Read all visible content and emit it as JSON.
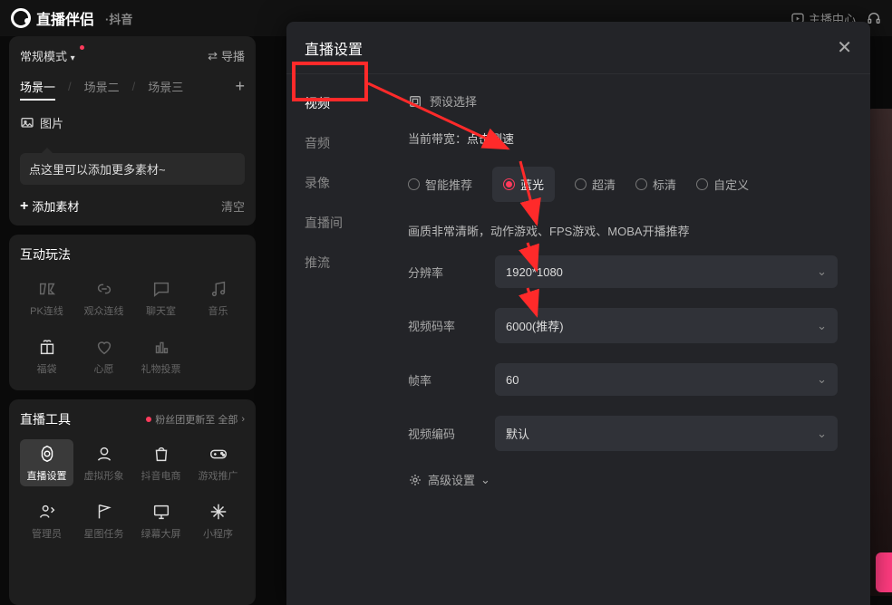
{
  "topbar": {
    "app_name": "直播伴侣",
    "sub": "·抖音",
    "host_center": "主播中心"
  },
  "left": {
    "mode": "常规模式",
    "mode_chevron": "▾",
    "guide": "导播",
    "scenes": [
      "场景一",
      "场景二",
      "场景三"
    ],
    "image_label": "图片",
    "tip": "点这里可以添加更多素材~",
    "add_material": "添加素材",
    "clear": "清空",
    "play_title": "互动玩法",
    "play_items": [
      "PK连线",
      "观众连线",
      "聊天室",
      "音乐",
      "福袋",
      "心愿",
      "礼物投票"
    ],
    "tool_title": "直播工具",
    "fans_update": "粉丝团更新至 全部",
    "tool_items": [
      "直播设置",
      "虚拟形象",
      "抖音电商",
      "游戏推广",
      "管理员",
      "星图任务",
      "绿幕大屏",
      "小程序"
    ]
  },
  "modal": {
    "title": "直播设置",
    "tabs": [
      "视频",
      "音频",
      "录像",
      "直播间",
      "推流"
    ],
    "preset_label": "预设选择",
    "bandwidth_label": "当前带宽：",
    "bandwidth_action": "点击测速",
    "radios": [
      "智能推荐",
      "蓝光",
      "超清",
      "标清",
      "自定义"
    ],
    "desc": "画质非常清晰，动作游戏、FPS游戏、MOBA开播推荐",
    "resolution_label": "分辨率",
    "resolution_value": "1920*1080",
    "bitrate_label": "视频码率",
    "bitrate_value": "6000(推荐)",
    "fps_label": "帧率",
    "fps_value": "60",
    "codec_label": "视频编码",
    "codec_value": "默认",
    "advanced": "高级设置"
  }
}
